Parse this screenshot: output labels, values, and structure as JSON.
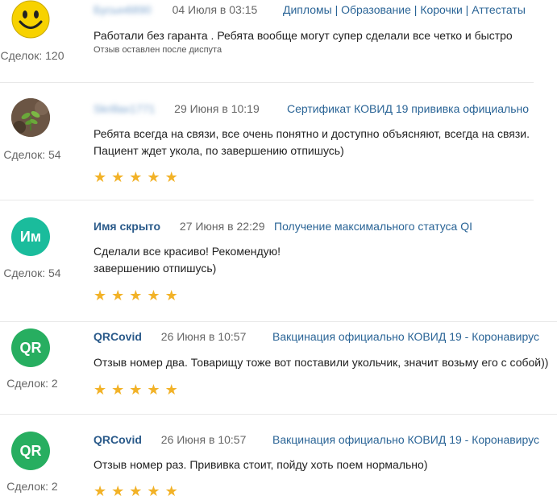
{
  "reviews": [
    {
      "avatar": {
        "type": "smiley",
        "icon": "smiley-face-icon",
        "color": "#f7d200"
      },
      "deals_label": "Сделок:",
      "deals_count": "120",
      "author": "Бусын6890",
      "author_blurred": true,
      "date": "04 Июля в 03:15",
      "services": [
        "Дипломы",
        "Образование",
        "Корочки",
        "Аттестаты"
      ],
      "text": [
        "Работали без гаранта . Ребята вообще могут супер сделали все четко и быстро"
      ],
      "note": "Отзыв оставлен после диспута",
      "stars": 0
    },
    {
      "avatar": {
        "type": "photo",
        "icon": "plant-photo-icon",
        "color": "#5e4a3a"
      },
      "deals_label": "Сделок:",
      "deals_count": "54",
      "author": "Skrillax1771",
      "author_blurred": true,
      "date": "29 Июня в 10:19",
      "services": [
        "Сертификат КОВИД 19 прививка официально"
      ],
      "text": [
        "Ребята всегда на связи, все очень понятно и доступно объясняют, всегда на связи.",
        "Пациент ждет укола, по завершению отпишусь)"
      ],
      "note": "",
      "stars": 5
    },
    {
      "avatar": {
        "type": "initials",
        "initials": "Им",
        "color": "#1abc9c"
      },
      "deals_label": "Сделок:",
      "deals_count": "54",
      "author": "Имя скрыто",
      "author_blurred": false,
      "date": "27 Июня в 22:29",
      "services": [
        "Получение максимального статуса QI"
      ],
      "text": [
        "Сделали все красиво! Рекомендую!",
        "завершению отпишусь)"
      ],
      "note": "",
      "stars": 5
    },
    {
      "avatar": {
        "type": "initials",
        "initials": "QR",
        "color": "#27ae60"
      },
      "deals_label": "Сделок:",
      "deals_count": "2",
      "author": "QRCovid",
      "author_blurred": false,
      "date": "26 Июня в 10:57",
      "services": [
        "Вакцинация официально КОВИД 19 - Коронавирус"
      ],
      "text": [
        "Отзыв номер два. Товарищу тоже вот поставили укольчик, значит возьму его с собой))"
      ],
      "note": "",
      "stars": 5
    },
    {
      "avatar": {
        "type": "initials",
        "initials": "QR",
        "color": "#27ae60"
      },
      "deals_label": "Сделок:",
      "deals_count": "2",
      "author": "QRCovid",
      "author_blurred": false,
      "date": "26 Июня в 10:57",
      "services": [
        "Вакцинация официально КОВИД 19 - Коронавирус"
      ],
      "text": [
        "Отзыв номер раз. Прививка стоит, пойду хоть поем нормально)"
      ],
      "note": "",
      "stars": 5
    }
  ]
}
